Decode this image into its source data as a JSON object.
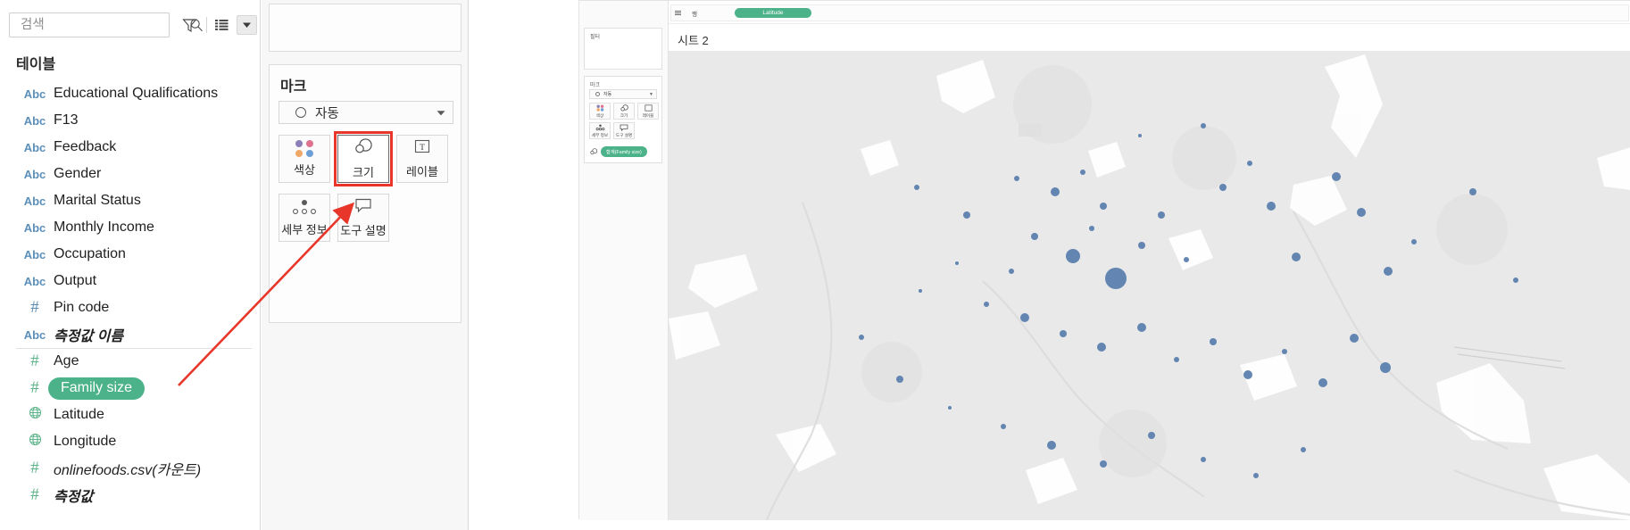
{
  "data_pane": {
    "search": {
      "placeholder": "검색",
      "value": ""
    },
    "icons": {
      "search": "search-icon",
      "filter": "filter-icon",
      "grid": "grid-view-icon",
      "sort": "sort-dropdown-icon"
    },
    "section_header": "테이블",
    "fields": [
      {
        "label": "Educational Qualifications",
        "icon": "abc",
        "type": "string",
        "selected": false,
        "style": "normal"
      },
      {
        "label": "F13",
        "icon": "abc",
        "type": "string",
        "selected": false,
        "style": "normal"
      },
      {
        "label": "Feedback",
        "icon": "abc",
        "type": "string",
        "selected": false,
        "style": "normal"
      },
      {
        "label": "Gender",
        "icon": "abc",
        "type": "string",
        "selected": false,
        "style": "normal"
      },
      {
        "label": "Marital Status",
        "icon": "abc",
        "type": "string",
        "selected": false,
        "style": "normal"
      },
      {
        "label": "Monthly Income",
        "icon": "abc",
        "type": "string",
        "selected": false,
        "style": "normal"
      },
      {
        "label": "Occupation",
        "icon": "abc",
        "type": "string",
        "selected": false,
        "style": "normal"
      },
      {
        "label": "Output",
        "icon": "abc",
        "type": "string",
        "selected": false,
        "style": "normal"
      },
      {
        "label": "Pin code",
        "icon": "hash",
        "type": "number",
        "selected": false,
        "style": "normal"
      },
      {
        "label": "측정값 이름",
        "icon": "abc",
        "type": "string",
        "selected": false,
        "style": "italic"
      },
      {
        "label": "Age",
        "icon": "hash-green",
        "type": "measure",
        "selected": false,
        "style": "normal",
        "divider": true
      },
      {
        "label": "Family size",
        "icon": "hash-green",
        "type": "measure",
        "selected": true,
        "style": "normal"
      },
      {
        "label": "Latitude",
        "icon": "globe-green",
        "type": "geo",
        "selected": false,
        "style": "normal"
      },
      {
        "label": "Longitude",
        "icon": "globe-green",
        "type": "geo",
        "selected": false,
        "style": "normal"
      },
      {
        "label": "onlinefoods.csv(카운트)",
        "icon": "hash-green",
        "type": "measure",
        "selected": false,
        "style": "italic-plain"
      },
      {
        "label": "측정값",
        "icon": "hash-green",
        "type": "measure",
        "selected": false,
        "style": "italic"
      }
    ]
  },
  "marks_card": {
    "title": "마크",
    "mark_type": "자동",
    "mark_type_icon": "circle-icon",
    "dropdown_icon": "chevron-down-icon",
    "buttons": [
      {
        "id": "color",
        "label": "색상",
        "icon": "color-palette-icon"
      },
      {
        "id": "size",
        "label": "크기",
        "icon": "size-circles-icon",
        "highlighted": true
      },
      {
        "id": "label",
        "label": "레이블",
        "icon": "text-label-icon"
      },
      {
        "id": "detail",
        "label": "세부 정보",
        "icon": "detail-dots-icon"
      },
      {
        "id": "tooltip",
        "label": "도구 설명",
        "icon": "tooltip-bubble-icon"
      }
    ],
    "highlight_color": "#e8372a"
  },
  "annotation": {
    "type": "red-arrow",
    "color": "#e8372a",
    "from_label": "Family size",
    "to_label": "크기"
  },
  "worksheet": {
    "rows_shelf": {
      "label": "행",
      "icon": "rows-shelf-icon",
      "pill": "Latitude"
    },
    "sheet_title": "시트 2",
    "mini_panel": {
      "filter_title": "필터",
      "marks_title": "마크",
      "mark_type": "자동",
      "buttons": [
        {
          "id": "color",
          "label": "색상"
        },
        {
          "id": "size",
          "label": "크기"
        },
        {
          "id": "label",
          "label": "레이블"
        },
        {
          "id": "detail",
          "label": "세부 정보"
        },
        {
          "id": "tooltip",
          "label": "도구 설명"
        }
      ],
      "size_pill": "합계(Family size)",
      "size_pill_icon": "size-circles-icon"
    },
    "map": {
      "mark_color": "#5b7fae",
      "background_color": "#e8e8e8",
      "land_color": "#ffffff"
    }
  },
  "chart_data": {
    "type": "scatter",
    "title": "시트 2",
    "encoding": {
      "geo": "Latitude / Longitude",
      "size": "합계(Family size)",
      "color": "#5b7fae"
    },
    "points": [
      {
        "x": 0.31,
        "y": 0.35,
        "r": 4
      },
      {
        "x": 0.362,
        "y": 0.272,
        "r": 3
      },
      {
        "x": 0.402,
        "y": 0.3,
        "r": 5
      },
      {
        "x": 0.43,
        "y": 0.258,
        "r": 3
      },
      {
        "x": 0.452,
        "y": 0.33,
        "r": 4
      },
      {
        "x": 0.38,
        "y": 0.395,
        "r": 4
      },
      {
        "x": 0.42,
        "y": 0.438,
        "r": 8
      },
      {
        "x": 0.356,
        "y": 0.47,
        "r": 3
      },
      {
        "x": 0.3,
        "y": 0.452,
        "r": 2
      },
      {
        "x": 0.465,
        "y": 0.485,
        "r": 12
      },
      {
        "x": 0.44,
        "y": 0.378,
        "r": 3
      },
      {
        "x": 0.492,
        "y": 0.415,
        "r": 4
      },
      {
        "x": 0.512,
        "y": 0.35,
        "r": 4
      },
      {
        "x": 0.538,
        "y": 0.445,
        "r": 3
      },
      {
        "x": 0.576,
        "y": 0.29,
        "r": 4
      },
      {
        "x": 0.604,
        "y": 0.24,
        "r": 3
      },
      {
        "x": 0.626,
        "y": 0.33,
        "r": 5
      },
      {
        "x": 0.652,
        "y": 0.44,
        "r": 5
      },
      {
        "x": 0.694,
        "y": 0.268,
        "r": 5
      },
      {
        "x": 0.72,
        "y": 0.345,
        "r": 5
      },
      {
        "x": 0.748,
        "y": 0.47,
        "r": 5
      },
      {
        "x": 0.775,
        "y": 0.406,
        "r": 3
      },
      {
        "x": 0.262,
        "y": 0.512,
        "r": 2
      },
      {
        "x": 0.33,
        "y": 0.54,
        "r": 3
      },
      {
        "x": 0.37,
        "y": 0.568,
        "r": 5
      },
      {
        "x": 0.41,
        "y": 0.602,
        "r": 4
      },
      {
        "x": 0.45,
        "y": 0.632,
        "r": 5
      },
      {
        "x": 0.492,
        "y": 0.59,
        "r": 5
      },
      {
        "x": 0.528,
        "y": 0.658,
        "r": 3
      },
      {
        "x": 0.566,
        "y": 0.62,
        "r": 4
      },
      {
        "x": 0.602,
        "y": 0.69,
        "r": 5
      },
      {
        "x": 0.64,
        "y": 0.64,
        "r": 3
      },
      {
        "x": 0.68,
        "y": 0.708,
        "r": 5
      },
      {
        "x": 0.712,
        "y": 0.612,
        "r": 5
      },
      {
        "x": 0.745,
        "y": 0.675,
        "r": 6
      },
      {
        "x": 0.2,
        "y": 0.61,
        "r": 3
      },
      {
        "x": 0.24,
        "y": 0.7,
        "r": 4
      },
      {
        "x": 0.292,
        "y": 0.76,
        "r": 2
      },
      {
        "x": 0.348,
        "y": 0.8,
        "r": 3
      },
      {
        "x": 0.398,
        "y": 0.84,
        "r": 5
      },
      {
        "x": 0.452,
        "y": 0.88,
        "r": 4
      },
      {
        "x": 0.502,
        "y": 0.82,
        "r": 4
      },
      {
        "x": 0.556,
        "y": 0.87,
        "r": 3
      },
      {
        "x": 0.61,
        "y": 0.905,
        "r": 3
      },
      {
        "x": 0.66,
        "y": 0.85,
        "r": 3
      },
      {
        "x": 0.836,
        "y": 0.3,
        "r": 4
      },
      {
        "x": 0.88,
        "y": 0.488,
        "r": 3
      },
      {
        "x": 0.258,
        "y": 0.29,
        "r": 3
      },
      {
        "x": 0.49,
        "y": 0.18,
        "r": 2
      },
      {
        "x": 0.556,
        "y": 0.16,
        "r": 3
      }
    ]
  }
}
